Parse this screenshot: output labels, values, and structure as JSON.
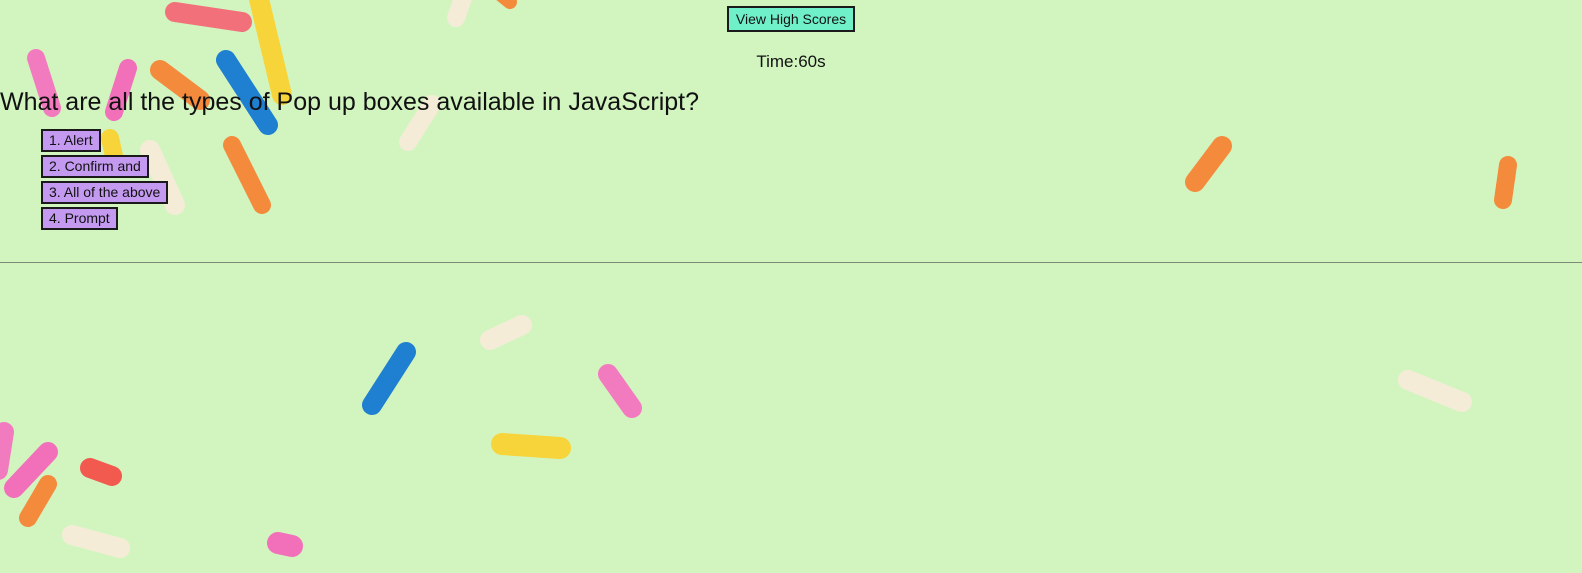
{
  "header": {
    "high_scores_label": "View High Scores"
  },
  "timer": {
    "text": "Time:60s"
  },
  "quiz": {
    "question": "What are all the types of Pop up boxes available in JavaScript?",
    "answers": [
      {
        "label": "1. Alert"
      },
      {
        "label": "2. Confirm and"
      },
      {
        "label": "3. All of the above"
      },
      {
        "label": "4. Prompt"
      }
    ]
  },
  "colors": {
    "background": "#d2f5c0",
    "high_scores_button": "#6ff0c8",
    "answer_button": "#c49af0",
    "border": "#1a1a1a"
  }
}
